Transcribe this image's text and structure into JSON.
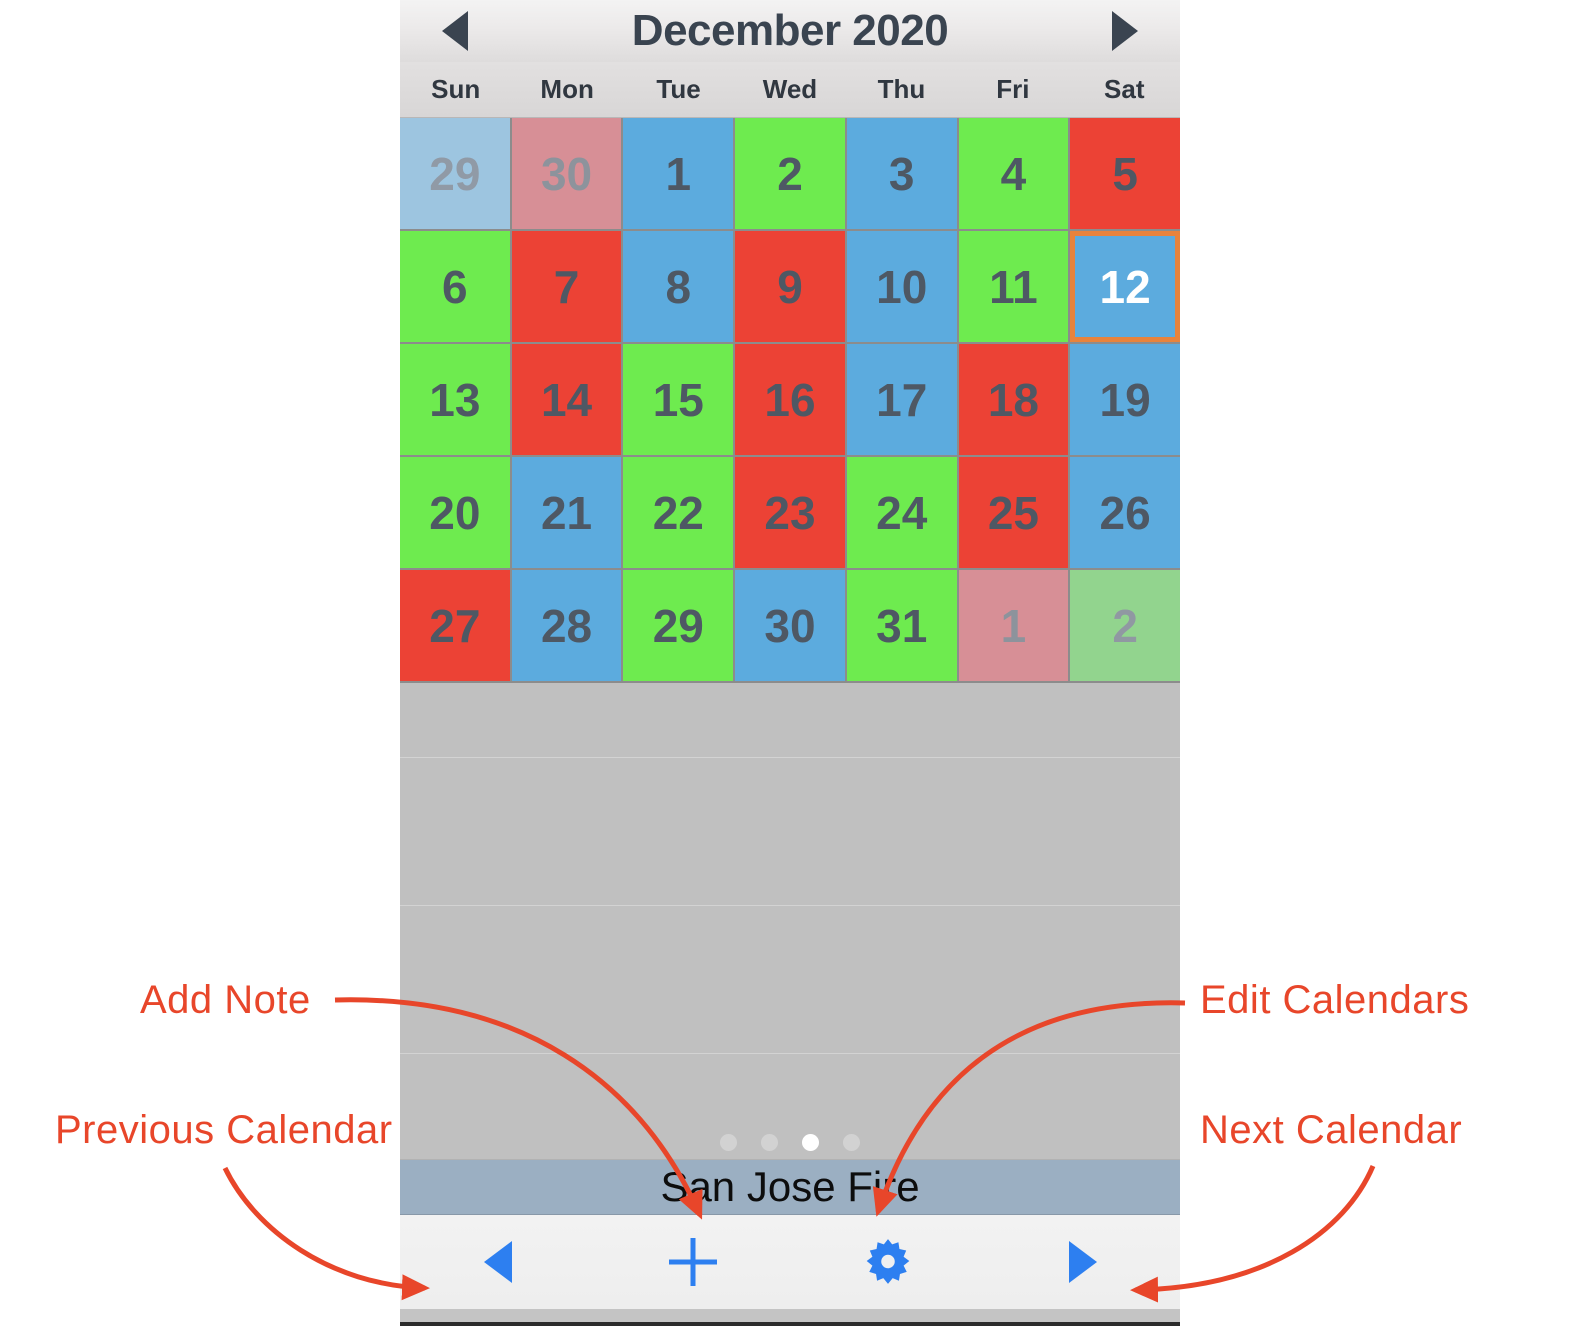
{
  "header": {
    "month_title": "December 2020",
    "prev_icon": "triangle-left-icon",
    "next_icon": "triangle-right-icon"
  },
  "weekdays": [
    "Sun",
    "Mon",
    "Tue",
    "Wed",
    "Thu",
    "Fri",
    "Sat"
  ],
  "calendar": {
    "selected_day": "12",
    "selection_border_color": "#e8833c",
    "colors": {
      "blue": "#5cabde",
      "green": "#6eeb4f",
      "red": "#ec4235",
      "blue_dim": "#9dc5e0",
      "red_dim": "#d78f96",
      "green_dim": "#92d48e",
      "day_text": "#4e5864",
      "dim_text": "#909aa6"
    },
    "weeks": [
      [
        {
          "day": "29",
          "color": "blue-dim",
          "outside": true,
          "selected": false
        },
        {
          "day": "30",
          "color": "red-dim",
          "outside": true,
          "selected": false
        },
        {
          "day": "1",
          "color": "blue",
          "outside": false,
          "selected": false
        },
        {
          "day": "2",
          "color": "green",
          "outside": false,
          "selected": false
        },
        {
          "day": "3",
          "color": "blue",
          "outside": false,
          "selected": false
        },
        {
          "day": "4",
          "color": "green",
          "outside": false,
          "selected": false
        },
        {
          "day": "5",
          "color": "red",
          "outside": false,
          "selected": false
        }
      ],
      [
        {
          "day": "6",
          "color": "green",
          "outside": false,
          "selected": false
        },
        {
          "day": "7",
          "color": "red",
          "outside": false,
          "selected": false
        },
        {
          "day": "8",
          "color": "blue",
          "outside": false,
          "selected": false
        },
        {
          "day": "9",
          "color": "red",
          "outside": false,
          "selected": false
        },
        {
          "day": "10",
          "color": "blue",
          "outside": false,
          "selected": false
        },
        {
          "day": "11",
          "color": "green",
          "outside": false,
          "selected": false
        },
        {
          "day": "12",
          "color": "blue",
          "outside": false,
          "selected": true
        }
      ],
      [
        {
          "day": "13",
          "color": "green",
          "outside": false,
          "selected": false
        },
        {
          "day": "14",
          "color": "red",
          "outside": false,
          "selected": false
        },
        {
          "day": "15",
          "color": "green",
          "outside": false,
          "selected": false
        },
        {
          "day": "16",
          "color": "red",
          "outside": false,
          "selected": false
        },
        {
          "day": "17",
          "color": "blue",
          "outside": false,
          "selected": false
        },
        {
          "day": "18",
          "color": "red",
          "outside": false,
          "selected": false
        },
        {
          "day": "19",
          "color": "blue",
          "outside": false,
          "selected": false
        }
      ],
      [
        {
          "day": "20",
          "color": "green",
          "outside": false,
          "selected": false
        },
        {
          "day": "21",
          "color": "blue",
          "outside": false,
          "selected": false
        },
        {
          "day": "22",
          "color": "green",
          "outside": false,
          "selected": false
        },
        {
          "day": "23",
          "color": "red",
          "outside": false,
          "selected": false
        },
        {
          "day": "24",
          "color": "green",
          "outside": false,
          "selected": false
        },
        {
          "day": "25",
          "color": "red",
          "outside": false,
          "selected": false
        },
        {
          "day": "26",
          "color": "blue",
          "outside": false,
          "selected": false
        }
      ],
      [
        {
          "day": "27",
          "color": "red",
          "outside": false,
          "selected": false
        },
        {
          "day": "28",
          "color": "blue",
          "outside": false,
          "selected": false
        },
        {
          "day": "29",
          "color": "green",
          "outside": false,
          "selected": false
        },
        {
          "day": "30",
          "color": "blue",
          "outside": false,
          "selected": false
        },
        {
          "day": "31",
          "color": "green",
          "outside": false,
          "selected": false
        },
        {
          "day": "1",
          "color": "red-dim",
          "outside": true,
          "selected": false
        },
        {
          "day": "2",
          "color": "green-dim",
          "outside": true,
          "selected": false
        }
      ]
    ]
  },
  "page_indicator": {
    "total": 4,
    "active_index": 2
  },
  "calendar_name_bar": {
    "name": "San Jose Fire",
    "background_color": "#9bafc2"
  },
  "toolbar": {
    "accent_color": "#2d7ff0",
    "buttons": [
      {
        "name": "previous-calendar-button",
        "icon": "triangle-left-icon",
        "label": ""
      },
      {
        "name": "add-note-button",
        "icon": "plus-icon",
        "label": ""
      },
      {
        "name": "edit-calendars-button",
        "icon": "gear-icon",
        "label": ""
      },
      {
        "name": "next-calendar-button",
        "icon": "triangle-right-icon",
        "label": ""
      }
    ]
  },
  "annotations": {
    "color": "#e8462a",
    "items": [
      {
        "id": "add-note",
        "label": "Add Note"
      },
      {
        "id": "previous-calendar",
        "label": "Previous Calendar"
      },
      {
        "id": "edit-calendars",
        "label": "Edit Calendars"
      },
      {
        "id": "next-calendar",
        "label": "Next Calendar"
      }
    ]
  }
}
